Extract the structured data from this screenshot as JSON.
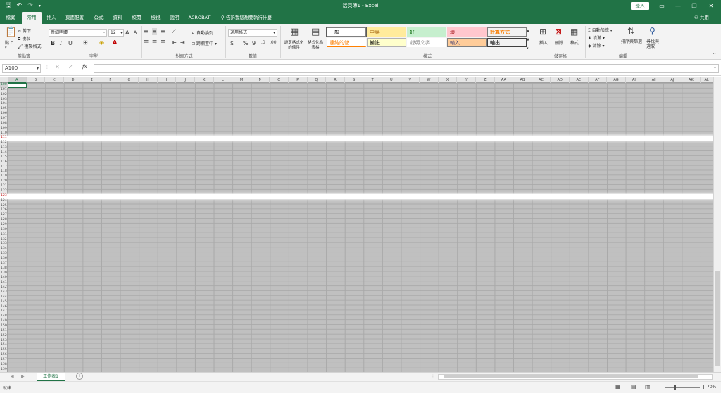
{
  "window": {
    "title": "活頁簿1 - Excel",
    "signin_label": "登入",
    "controls": [
      "▭",
      "—",
      "❐",
      "✕"
    ]
  },
  "quick_access": {
    "icons": [
      "save-icon",
      "undo-icon",
      "redo-icon",
      "customize-icon"
    ],
    "glyphs": [
      "🖫",
      "↶",
      "↷",
      "▾"
    ]
  },
  "tabs": [
    "檔案",
    "常用",
    "插入",
    "頁面配置",
    "公式",
    "資料",
    "校閱",
    "檢視",
    "說明",
    "ACROBAT"
  ],
  "active_tab": "常用",
  "tell_me": "告訴我您想要執行什麼",
  "share_label": "共用",
  "ribbon": {
    "clipboard": {
      "paste": "貼上",
      "cut": "剪下",
      "copy": "複製",
      "format_painter": "複製格式",
      "label": "剪貼簿"
    },
    "font": {
      "font_name": "新細明體",
      "font_size": "12",
      "bold": "B",
      "italic": "I",
      "underline": "U",
      "grow": "A",
      "shrink": "A",
      "label": "字型"
    },
    "alignment": {
      "wrap_text": "自動換列",
      "merge_center": "跨欄置中",
      "label": "對齊方式"
    },
    "number": {
      "format": "通用格式",
      "currency": "$",
      "percent": "%",
      "comma": "9",
      "label": "數值"
    },
    "styles": {
      "conditional": [
        "設定格式化",
        "的條件"
      ],
      "as_table": [
        "格式化為",
        "表格"
      ],
      "cells": [
        {
          "text": "一般",
          "bg": "#ffffff",
          "color": "#000000",
          "border": "#7f7f7f"
        },
        {
          "text": "中等",
          "bg": "#ffeb9c",
          "color": "#9c5700",
          "border": "#ffeb9c"
        },
        {
          "text": "好",
          "bg": "#c6efce",
          "color": "#006100",
          "border": "#c6efce"
        },
        {
          "text": "壞",
          "bg": "#ffc7ce",
          "color": "#9c0006",
          "border": "#ffc7ce"
        },
        {
          "text": "計算方式",
          "bg": "#f2f2f2",
          "color": "#fa7d00",
          "border": "#7f7f7f"
        },
        {
          "text": "連結的儲...",
          "bg": "#ffffff",
          "color": "#fa7d00",
          "border": "#ffffff"
        },
        {
          "text": "備註",
          "bg": "#ffffcc",
          "color": "#000000",
          "border": "#b2b2b2"
        },
        {
          "text": "說明文字",
          "bg": "#ffffff",
          "color": "#7f7f7f",
          "border": "#ffffff"
        },
        {
          "text": "輸入",
          "bg": "#ffcc99",
          "color": "#3f3f76",
          "border": "#7f7f7f"
        },
        {
          "text": "輸出",
          "bg": "#f2f2f2",
          "color": "#3f3f3f",
          "border": "#3f3f3f"
        }
      ],
      "label": "樣式"
    },
    "cells_group": {
      "insert": "插入",
      "delete": "刪除",
      "format": "格式",
      "label": "儲存格"
    },
    "editing": {
      "autosum": "自動加總",
      "fill": "填滿",
      "clear": "清除",
      "sort_filter": [
        "排序與篩選"
      ],
      "find_select": [
        "尋找與",
        "選取"
      ],
      "label": "編輯"
    }
  },
  "formula_bar": {
    "name_box": "A100",
    "cancel": "✕",
    "enter": "✓",
    "fx": "fx"
  },
  "grid": {
    "columns": [
      "A",
      "B",
      "C",
      "D",
      "E",
      "F",
      "G",
      "H",
      "I",
      "J",
      "K",
      "L",
      "M",
      "N",
      "O",
      "P",
      "Q",
      "R",
      "S",
      "T",
      "U",
      "V",
      "W",
      "X",
      "Y",
      "Z",
      "AA",
      "AB",
      "AC",
      "AD",
      "AE",
      "AF",
      "AG",
      "AH",
      "AI",
      "AJ",
      "AK",
      "AL"
    ],
    "first_row": 100,
    "last_row": 159,
    "highlight_rows": [
      111,
      123
    ]
  },
  "sheet": {
    "tab_name": "工作表1",
    "add_sheet": "+",
    "nav_prev": "◀",
    "nav_next": "▶",
    "more": "⋮"
  },
  "status": {
    "ready": "就緒",
    "zoom": "70%",
    "zoom_minus": "−",
    "zoom_plus": "+"
  },
  "colors": {
    "excel_green": "#217346",
    "ribbon_bg": "#f3f3f3",
    "grid_bg": "#c0c0c0",
    "highlight_row": "#ffffff"
  }
}
